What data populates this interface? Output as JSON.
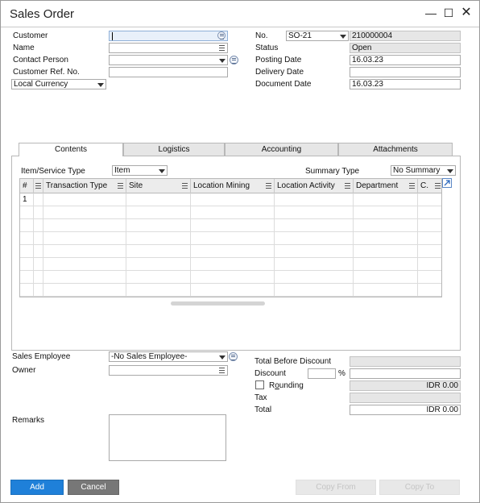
{
  "window": {
    "title": "Sales Order",
    "controls": [
      "minimize-icon",
      "maximize-icon",
      "close-icon"
    ]
  },
  "header_left": {
    "customer_label": "Customer",
    "customer_value": "",
    "name_label": "Name",
    "name_value": "",
    "contact_person_label": "Contact Person",
    "contact_person_value": "",
    "customer_ref_label": "Customer Ref. No.",
    "customer_ref_value": "",
    "currency_selected": "Local Currency"
  },
  "header_right": {
    "no_label": "No.",
    "series_selected": "SO-21",
    "doc_number": "210000004",
    "status_label": "Status",
    "status_value": "Open",
    "posting_date_label": "Posting Date",
    "posting_date_value": "16.03.23",
    "delivery_date_label": "Delivery Date",
    "delivery_date_value": "",
    "document_date_label": "Document Date",
    "document_date_value": "16.03.23"
  },
  "tabs": [
    "Contents",
    "Logistics",
    "Accounting",
    "Attachments"
  ],
  "active_tab": "Contents",
  "contents": {
    "item_service_type_label": "Item/Service Type",
    "item_service_type_selected": "Item",
    "summary_type_label": "Summary Type",
    "summary_type_selected": "No Summary",
    "columns": [
      "#",
      "",
      "Transaction Type",
      "Site",
      "Location Mining",
      "Location Activity",
      "Department",
      "C."
    ],
    "rows": [
      [
        "1",
        "",
        "",
        "",
        "",
        "",
        "",
        ""
      ],
      [
        "",
        "",
        "",
        "",
        "",
        "",
        "",
        ""
      ],
      [
        "",
        "",
        "",
        "",
        "",
        "",
        "",
        ""
      ],
      [
        "",
        "",
        "",
        "",
        "",
        "",
        "",
        ""
      ],
      [
        "",
        "",
        "",
        "",
        "",
        "",
        "",
        ""
      ],
      [
        "",
        "",
        "",
        "",
        "",
        "",
        "",
        ""
      ],
      [
        "",
        "",
        "",
        "",
        "",
        "",
        "",
        ""
      ],
      [
        "",
        "",
        "",
        "",
        "",
        "",
        "",
        ""
      ]
    ]
  },
  "footer_left": {
    "sales_employee_label": "Sales Employee",
    "sales_employee_selected": "-No Sales Employee-",
    "owner_label": "Owner",
    "owner_value": "",
    "remarks_label": "Remarks",
    "remarks_value": ""
  },
  "totals": {
    "total_before_discount_label": "Total Before Discount",
    "total_before_discount_value": "",
    "discount_label": "Discount",
    "discount_percent": "",
    "percent_sign": "%",
    "discount_amount": "",
    "rounding_label_prefix": "R",
    "rounding_label_underlined": "o",
    "rounding_label_suffix": "unding",
    "rounding_checked": false,
    "rounding_value": "IDR 0.00",
    "tax_label": "Tax",
    "tax_value": "",
    "total_label": "Total",
    "total_value": "IDR 0.00"
  },
  "buttons": {
    "add": "Add",
    "cancel": "Cancel",
    "copy_from": "Copy From",
    "copy_to": "Copy To"
  },
  "colors": {
    "primary_button": "#1f80d9",
    "secondary_button": "#777777",
    "readonly_field": "#e6e6e6",
    "focus_field": "#e8f0fa"
  }
}
